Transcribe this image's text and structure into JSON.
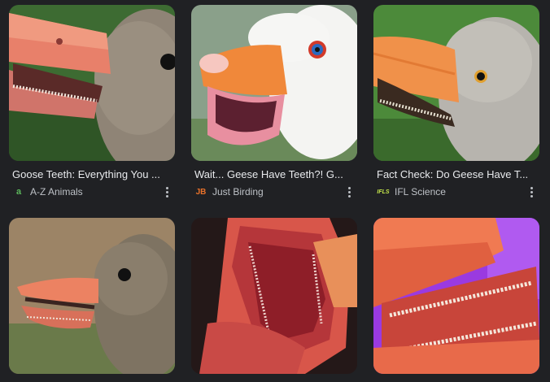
{
  "results": [
    {
      "title": "Goose Teeth: Everything You ...",
      "source": "A-Z Animals",
      "favicon": {
        "glyph": "a",
        "name": "az-animals-favicon-icon",
        "color": "#5cb85c"
      }
    },
    {
      "title": "Wait... Geese Have Teeth?! G...",
      "source": "Just Birding",
      "favicon": {
        "glyph": "JB",
        "name": "just-birding-favicon-icon",
        "color": "#e8712a"
      }
    },
    {
      "title": "Fact Check: Do Geese Have T...",
      "source": "IFL Science",
      "favicon": {
        "glyph": "IFLS",
        "name": "ifl-science-favicon-icon",
        "color": "#c6e84b"
      }
    },
    {
      "image_only": true
    },
    {
      "image_only": true
    },
    {
      "image_only": true
    }
  ]
}
